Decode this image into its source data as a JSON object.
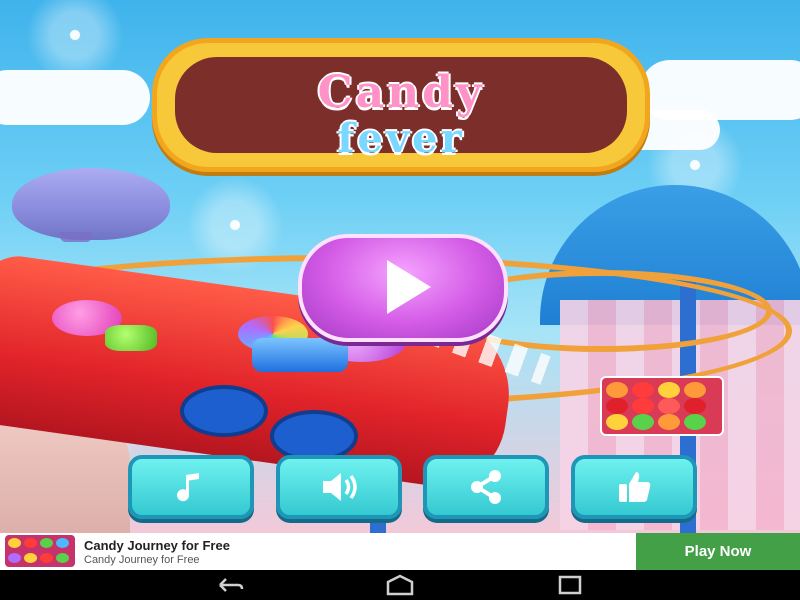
{
  "logo": {
    "line1": "Candy",
    "line2": "fever"
  },
  "play_button": {
    "icon": "play-icon"
  },
  "menu": [
    {
      "name": "music-button",
      "icon": "music-note-icon"
    },
    {
      "name": "sound-button",
      "icon": "speaker-icon"
    },
    {
      "name": "share-button",
      "icon": "share-icon"
    },
    {
      "name": "like-button",
      "icon": "thumbs-up-icon"
    }
  ],
  "promo_tile": {
    "icon": "candy-game-promo-icon"
  },
  "ad": {
    "title": "Candy Journey for Free",
    "subtitle": "Candy Journey for Free",
    "cta": "Play Now",
    "cta_color": "#43a047"
  },
  "nav": [
    {
      "name": "back-button",
      "icon": "back-arrow-icon"
    },
    {
      "name": "home-button",
      "icon": "home-icon"
    },
    {
      "name": "recents-button",
      "icon": "recents-icon"
    }
  ],
  "colors": {
    "menu_button": "#34c9d1",
    "play_button": "#d35be6",
    "logo_frame": "#f7c93a"
  }
}
